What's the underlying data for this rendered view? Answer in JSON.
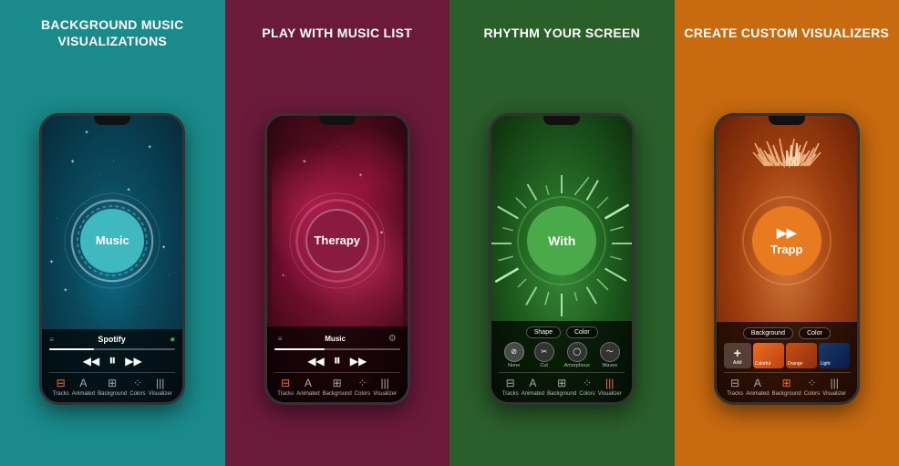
{
  "panels": [
    {
      "id": "panel-1",
      "title": "BACKGROUND MUSIC\nVISUALIZATIONS",
      "bg_color": "#1a8a8a",
      "phone_label": "Music",
      "bottom_label": "Spotify",
      "ring_color": "#40b8c0",
      "icons": [
        {
          "symbol": "⊟",
          "label": "Tracks",
          "active": true
        },
        {
          "symbol": "A",
          "label": "Animated"
        },
        {
          "symbol": "⊞",
          "label": "Background"
        },
        {
          "symbol": "⁘",
          "label": "Colors"
        },
        {
          "symbol": "|||",
          "label": "Visualizer"
        }
      ]
    },
    {
      "id": "panel-2",
      "title": "PLAY WITH\nMUSIC LIST",
      "bg_color": "#6b1a3a",
      "phone_label": "Therapy",
      "bottom_label": "Music",
      "ring_color": "#8b1a40",
      "icons": [
        {
          "symbol": "⊟",
          "label": "Tracks",
          "active": true
        },
        {
          "symbol": "A",
          "label": "Animated"
        },
        {
          "symbol": "⊞",
          "label": "Background"
        },
        {
          "symbol": "⁘",
          "label": "Colors"
        },
        {
          "symbol": "|||",
          "label": "Visualizer"
        }
      ]
    },
    {
      "id": "panel-3",
      "title": "RHYTHM\nYOUR SCREEN",
      "bg_color": "#2a5e2a",
      "phone_label": "With",
      "ring_color": "#4aaa4a",
      "controls": [
        "Shape",
        "Color"
      ],
      "tools": [
        "None",
        "Cut",
        "Amorphous",
        "Waves"
      ],
      "icons": [
        {
          "symbol": "⊟",
          "label": "Tracks"
        },
        {
          "symbol": "A",
          "label": "Animated"
        },
        {
          "symbol": "⊞",
          "label": "Background"
        },
        {
          "symbol": "⁘",
          "label": "Colors"
        },
        {
          "symbol": "|||",
          "label": "Visualizer",
          "active": true
        }
      ]
    },
    {
      "id": "panel-4",
      "title": "CREATE CUSTOM\nVISUALIZERS",
      "bg_color": "#c86a10",
      "phone_label": "Trapp",
      "ring_color": "#e87a20",
      "controls": [
        "Background",
        "Color"
      ],
      "thumbs": [
        "Add",
        "Colorful",
        "Orange",
        "Light"
      ],
      "icons": [
        {
          "symbol": "⊟",
          "label": "Tracks"
        },
        {
          "symbol": "A",
          "label": "Animated"
        },
        {
          "symbol": "⊞",
          "label": "Background",
          "active": true
        },
        {
          "symbol": "⁘",
          "label": "Colors"
        },
        {
          "symbol": "|||",
          "label": "Visualizer"
        }
      ]
    }
  ]
}
